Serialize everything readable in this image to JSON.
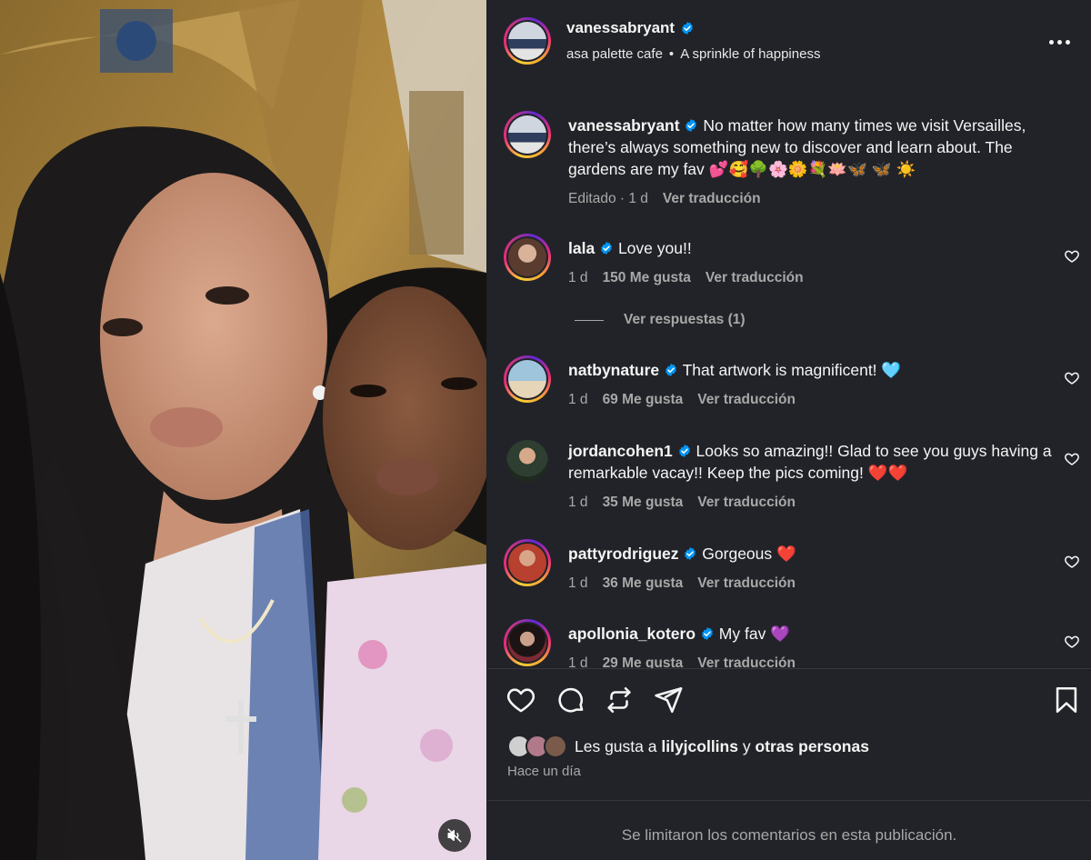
{
  "post": {
    "username": "vanessabryant",
    "location": "asa palette cafe",
    "audio": "A sprinkle of happiness",
    "caption_user": "vanessabryant",
    "caption_text": "No matter how many times we visit Versailles, there’s always something new to discover and learn about. The gardens are my fav 💕🥰🌳🌸🌼💐🪷🦋 🦋 ☀️",
    "caption_meta_edited": "Editado · 1 d",
    "caption_meta_translate": "Ver traducción"
  },
  "comments": [
    {
      "user": "lala",
      "text": "Love you!!",
      "time": "1 d",
      "likes": "150 Me gusta",
      "translate": "Ver traducción",
      "replies": "Ver respuestas (1)",
      "avatar_color": "#8d6e5a"
    },
    {
      "user": "natbynature",
      "text": "That artwork is magnificent! 🩵",
      "time": "1 d",
      "likes": "69 Me gusta",
      "translate": "Ver traducción",
      "avatar_color": "#a8c6d8"
    },
    {
      "user": "jordancohen1",
      "text": "Looks so amazing!! Glad to see you guys having a remarkable vacay!! Keep the pics coming! ❤️❤️",
      "time": "1 d",
      "likes": "35 Me gusta",
      "translate": "Ver traducción",
      "avatar_color": "#3f6b3a"
    },
    {
      "user": "pattyrodriguez",
      "text": "Gorgeous ❤️",
      "time": "1 d",
      "likes": "36 Me gusta",
      "translate": "Ver traducción",
      "avatar_color": "#c4473a"
    },
    {
      "user": "apollonia_kotero",
      "text": "My fav 💜",
      "time": "1 d",
      "likes": "29 Me gusta",
      "translate": "Ver traducción",
      "avatar_color": "#3a2a2e"
    }
  ],
  "footer": {
    "likes_prefix": "Les gusta a",
    "likes_user": "lilyjcollins",
    "likes_and": "y",
    "likes_others": "otras personas",
    "time_ago": "Hace un día",
    "comments_limited": "Se limitaron los comentarios en esta publicación."
  },
  "colors": {
    "panel_bg": "#212328",
    "text_primary": "#f5f5f5",
    "text_secondary": "#a8a8a8",
    "verified_blue": "#0095f6"
  }
}
